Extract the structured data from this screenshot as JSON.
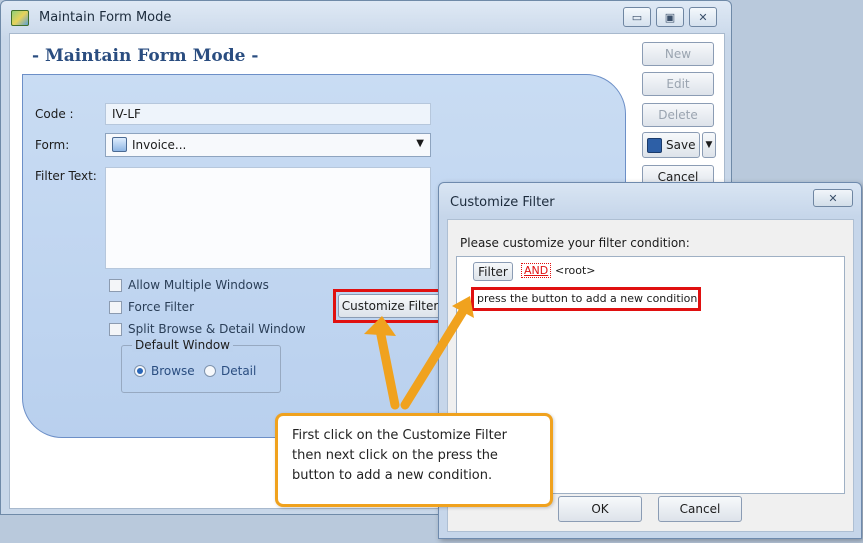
{
  "window": {
    "title": "Maintain Form Mode",
    "heading": "- Maintain Form Mode -",
    "controls": {
      "minimize": "▭",
      "maximize": "▣",
      "close": "✕"
    }
  },
  "form": {
    "code_label": "Code :",
    "code_value": "IV-LF",
    "form_label": "Form:",
    "form_value": "Invoice...",
    "filter_label": "Filter Text:",
    "filter_value": "",
    "checkboxes": [
      {
        "label": "Allow Multiple Windows",
        "checked": false
      },
      {
        "label": "Force Filter",
        "checked": false
      },
      {
        "label": "Split Browse & Detail Window",
        "checked": false
      }
    ],
    "default_window": {
      "label": "Default Window",
      "options": [
        {
          "label": "Browse",
          "selected": true
        },
        {
          "label": "Detail",
          "selected": false
        }
      ]
    },
    "customize_filter_button": "Customize Filter"
  },
  "side_buttons": {
    "new": "New",
    "edit": "Edit",
    "delete": "Delete",
    "save": "Save",
    "cancel": "Cancel"
  },
  "dialog": {
    "title": "Customize Filter",
    "close": "✕",
    "prompt": "Please customize your filter condition:",
    "filter_button": "Filter",
    "operator": "AND",
    "root": "<root>",
    "add_condition": "press the button to add a new condition",
    "ok": "OK",
    "cancel": "Cancel"
  },
  "callout": {
    "text": "First click on the Customize Filter then next click on the press the button to add a new condition."
  },
  "colors": {
    "highlight": "#e01010",
    "callout_border": "#f0a21e",
    "heading": "#2a4d80"
  }
}
